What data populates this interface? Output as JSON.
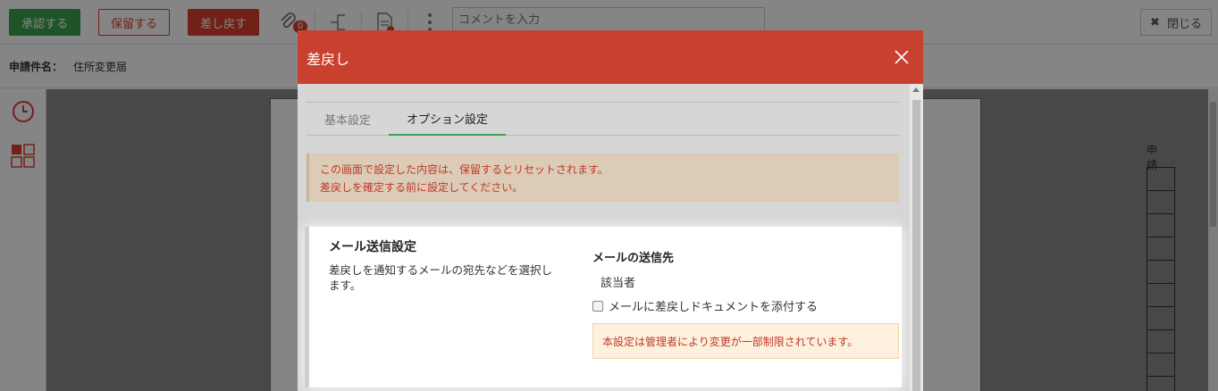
{
  "toolbar": {
    "approve_label": "承認する",
    "hold_label": "保留する",
    "return_label": "差し戻す",
    "attachment_count": "0",
    "comment_placeholder": "コメントを入力",
    "close_label": "閉じる",
    "approve_color": "#3ca14e",
    "return_color": "#d9402e"
  },
  "subject": {
    "label": "申請件名：",
    "value": "住所変更届"
  },
  "document": {
    "side_text": "申 請"
  },
  "modal": {
    "title": "差戻し",
    "header_color": "#c9402f",
    "tabs": [
      {
        "label": "基本設定",
        "active": false
      },
      {
        "label": "オプション設定",
        "active": true
      }
    ],
    "notice": {
      "line1": "この画面で設定した内容は、保留するとリセットされます。",
      "line2": "差戻しを確定する前に設定してください。"
    },
    "mail_settings": {
      "title": "メール送信設定",
      "description": "差戻しを通知するメールの宛先などを選択します。",
      "destination_label": "メールの送信先",
      "destination_value": "該当者",
      "attach_label": "メールに差戻しドキュメントを添付する",
      "attach_checked": false,
      "restriction_note": "本設定は管理者により変更が一部制限されています。"
    }
  }
}
